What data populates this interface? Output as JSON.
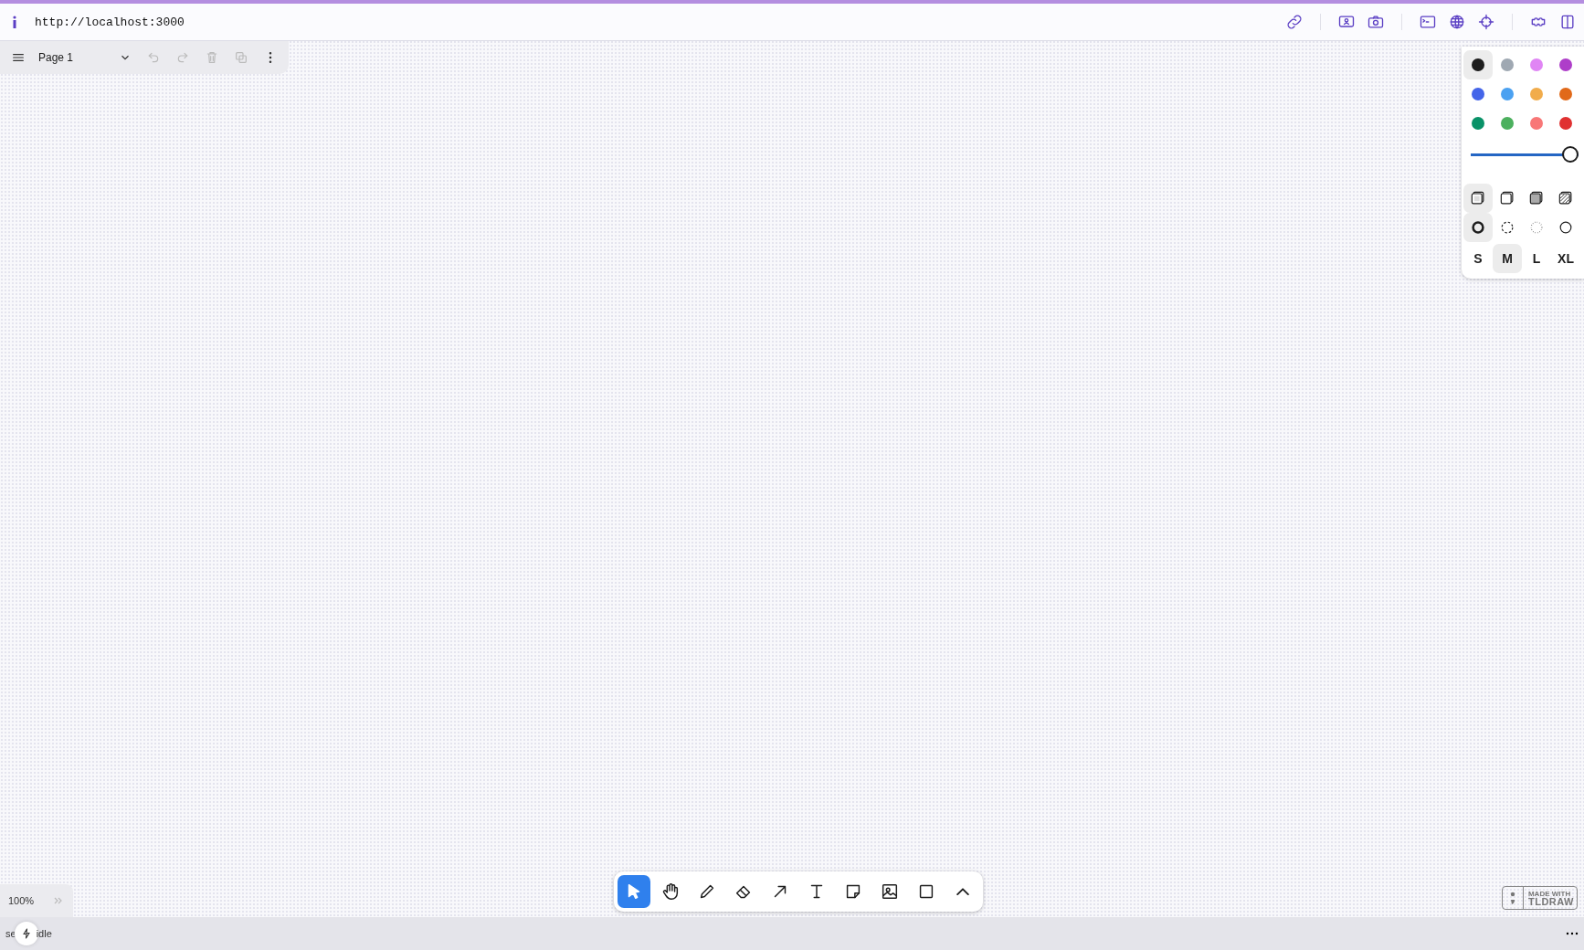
{
  "address_bar": {
    "url": "http://localhost:3000"
  },
  "page_menu": {
    "page_name": "Page 1"
  },
  "style_panel": {
    "colors": [
      {
        "color": "#1d1d1d",
        "selected": true
      },
      {
        "color": "#9fa8b2",
        "selected": false
      },
      {
        "color": "#e085f4",
        "selected": false
      },
      {
        "color": "#ae3ec9",
        "selected": false
      },
      {
        "color": "#4465e9",
        "selected": false
      },
      {
        "color": "#4ba1f1",
        "selected": false
      },
      {
        "color": "#f1ac4b",
        "selected": false
      },
      {
        "color": "#e16919",
        "selected": false
      },
      {
        "color": "#099268",
        "selected": false
      },
      {
        "color": "#4cb05e",
        "selected": false
      },
      {
        "color": "#f87777",
        "selected": false
      },
      {
        "color": "#e03131",
        "selected": false
      }
    ],
    "opacity": {
      "level": 1
    },
    "fills": [
      {
        "kind": "none",
        "selected": true
      },
      {
        "kind": "semi",
        "selected": false
      },
      {
        "kind": "solid",
        "selected": false
      },
      {
        "kind": "pattern",
        "selected": false
      }
    ],
    "dashes": [
      {
        "kind": "draw",
        "selected": true
      },
      {
        "kind": "dashed",
        "selected": false
      },
      {
        "kind": "dotted",
        "selected": false
      },
      {
        "kind": "solid",
        "selected": false
      }
    ],
    "sizes": [
      {
        "label": "S",
        "selected": false
      },
      {
        "label": "M",
        "selected": true
      },
      {
        "label": "L",
        "selected": false
      },
      {
        "label": "XL",
        "selected": false
      }
    ]
  },
  "toolbar": {
    "tools": [
      {
        "kind": "select",
        "selected": true
      },
      {
        "kind": "hand",
        "selected": false
      },
      {
        "kind": "draw",
        "selected": false
      },
      {
        "kind": "eraser",
        "selected": false
      },
      {
        "kind": "arrow",
        "selected": false
      },
      {
        "kind": "text",
        "selected": false
      },
      {
        "kind": "note",
        "selected": false
      },
      {
        "kind": "image",
        "selected": false
      },
      {
        "kind": "rectangle",
        "selected": false
      },
      {
        "kind": "more",
        "selected": false
      }
    ]
  },
  "zoom": {
    "text": "100%"
  },
  "status": {
    "texts": [
      "se",
      "idle"
    ]
  },
  "badge": {
    "line_1": "MADE WITH",
    "line_2": "TLDRAW"
  }
}
